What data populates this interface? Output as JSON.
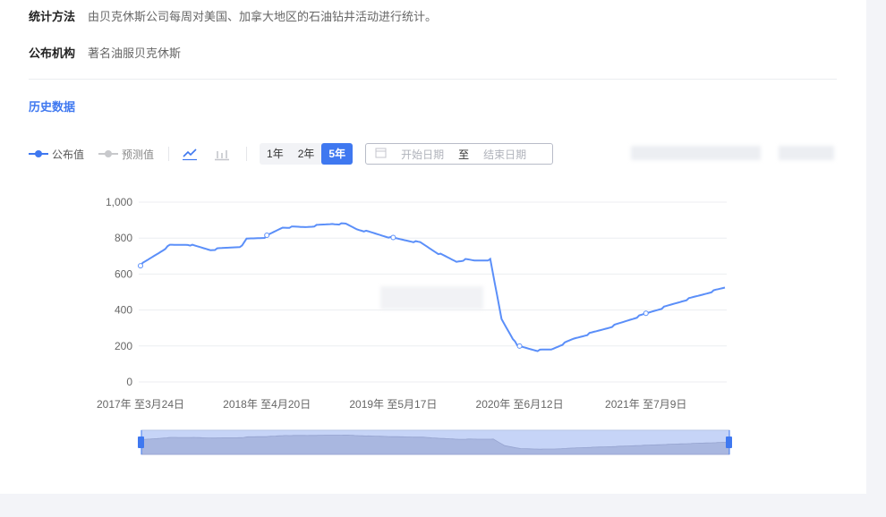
{
  "info": {
    "method_label": "统计方法",
    "method_value": "由贝克休斯公司每周对美国、加拿大地区的石油钻井活动进行统计。",
    "publisher_label": "公布机构",
    "publisher_value": "著名油服贝克休斯"
  },
  "section_title": "历史数据",
  "toolbar": {
    "legend_published": "公布值",
    "legend_forecast": "预测值",
    "ranges": [
      "1年",
      "2年",
      "5年"
    ],
    "active_range": "5年",
    "start_placeholder": "开始日期",
    "to": "至",
    "end_placeholder": "结束日期"
  },
  "colors": {
    "accent": "#3f78f0",
    "line": "#5b8ff9",
    "forecast": "#c8c9cc"
  },
  "chart_data": {
    "type": "line",
    "title": "",
    "xlabel": "",
    "ylabel": "",
    "ylim": [
      0,
      1000
    ],
    "yticks": [
      "0",
      "200",
      "400",
      "600",
      "800",
      "1,000"
    ],
    "ytick_values": [
      0,
      200,
      400,
      600,
      800,
      1000
    ],
    "xticks": [
      "2017年 至3月24日",
      "2018年 至4月20日",
      "2019年 至5月17日",
      "2020年 至6月12日",
      "2021年 至7月9日"
    ],
    "xtick_weeks": [
      0,
      56,
      112,
      168,
      224
    ],
    "x_max": 259,
    "series": [
      {
        "name": "公布值",
        "points": [
          [
            0,
            650
          ],
          [
            13,
            760
          ],
          [
            21,
            765
          ],
          [
            31,
            735
          ],
          [
            41,
            750
          ],
          [
            45,
            755
          ],
          [
            47,
            795
          ],
          [
            55,
            805
          ],
          [
            63,
            860
          ],
          [
            73,
            862
          ],
          [
            85,
            880
          ],
          [
            91,
            878
          ],
          [
            96,
            850
          ],
          [
            112,
            800
          ],
          [
            124,
            775
          ],
          [
            132,
            715
          ],
          [
            140,
            670
          ],
          [
            144,
            680
          ],
          [
            148,
            675
          ],
          [
            155,
            680
          ],
          [
            160,
            350
          ],
          [
            167,
            200
          ],
          [
            176,
            175
          ],
          [
            182,
            180
          ],
          [
            192,
            240
          ],
          [
            208,
            305
          ],
          [
            224,
            380
          ],
          [
            240,
            450
          ],
          [
            255,
            510
          ],
          [
            259,
            525
          ]
        ]
      }
    ]
  }
}
